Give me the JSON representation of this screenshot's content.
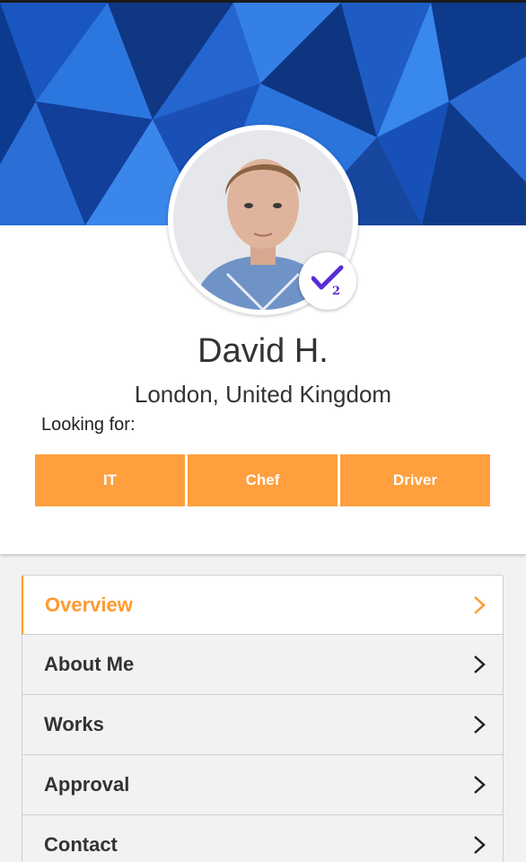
{
  "profile": {
    "name": "David H.",
    "location": "London, United Kingdom",
    "verification_count": "2"
  },
  "looking_for": {
    "label": "Looking for:",
    "tags": [
      "IT",
      "Chef",
      "Driver"
    ]
  },
  "menu": {
    "items": [
      {
        "label": "Overview",
        "active": true
      },
      {
        "label": "About Me",
        "active": false
      },
      {
        "label": "Works",
        "active": false
      },
      {
        "label": "Approval",
        "active": false
      },
      {
        "label": "Contact",
        "active": false
      }
    ]
  },
  "colors": {
    "accent": "#ff9f3d",
    "active_text": "#ff9a2f",
    "banner": "#1f63cc",
    "verify": "#5a2bd6"
  },
  "icons": {
    "chevron": "chevron-right-icon",
    "verified": "verified-check-icon"
  }
}
